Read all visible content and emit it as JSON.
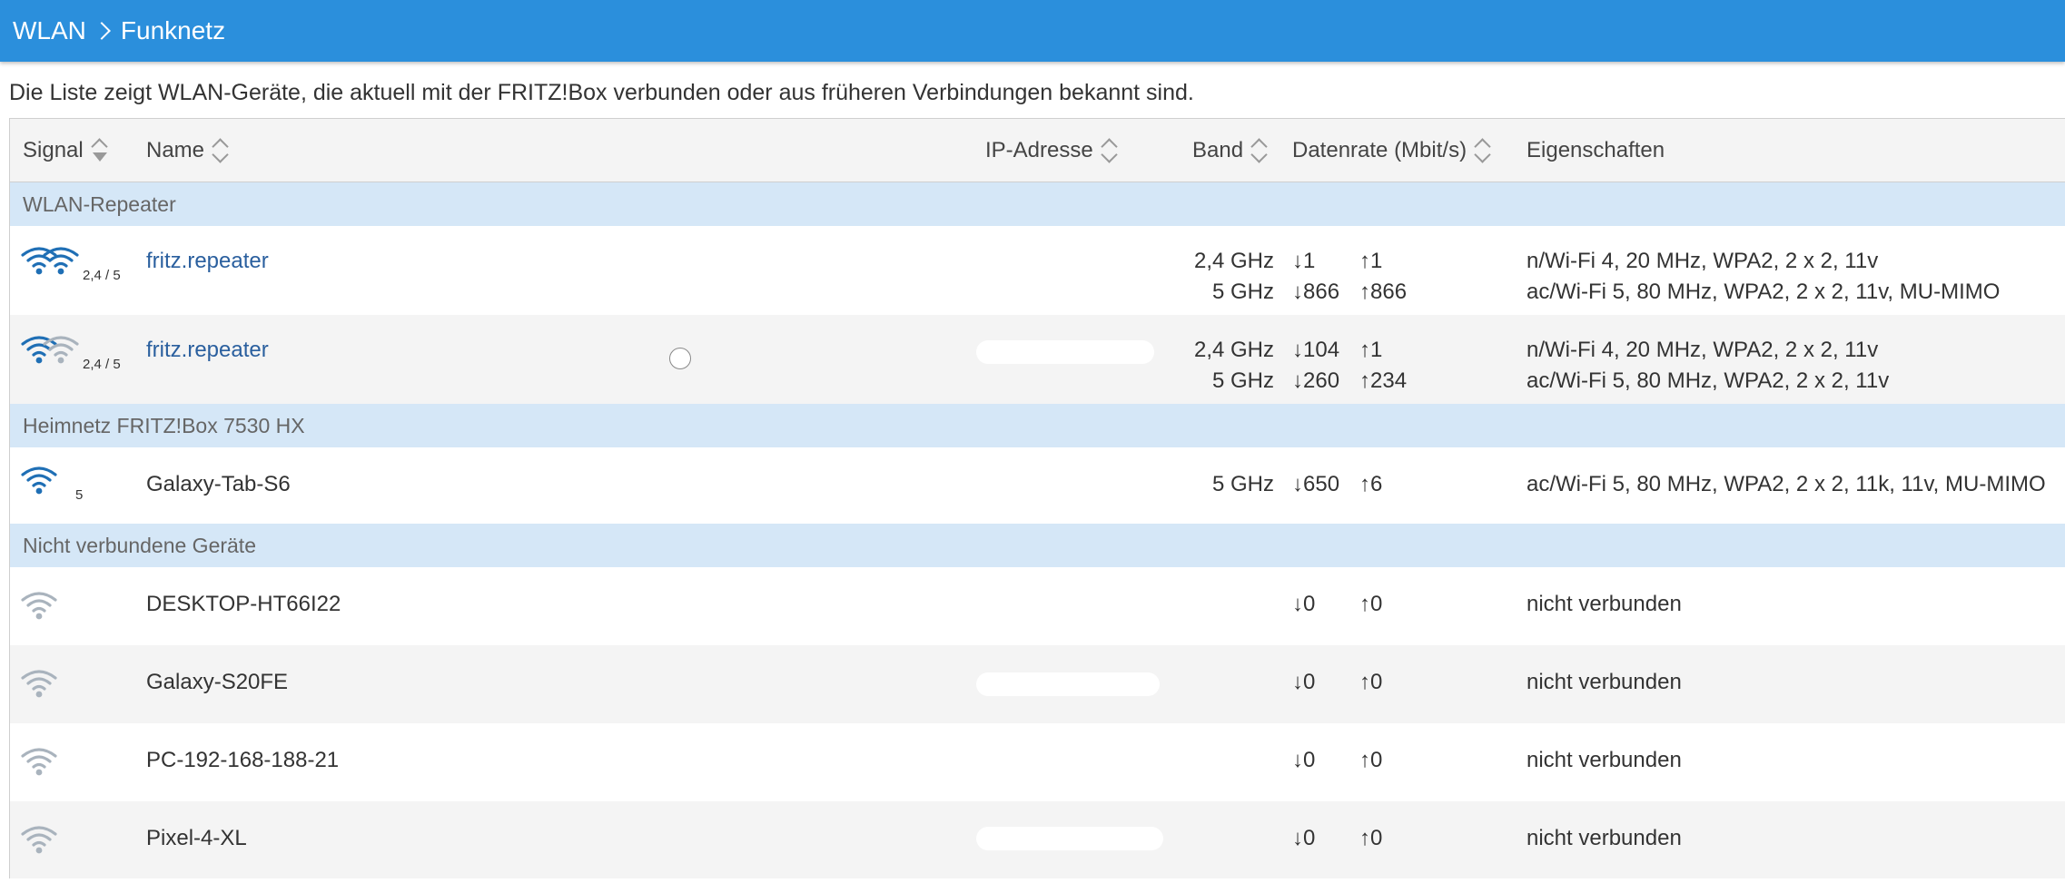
{
  "header": {
    "crumb_wlan": "WLAN",
    "crumb_page": "Funknetz"
  },
  "intro": "Die Liste zeigt WLAN-Geräte, die aktuell mit der FRITZ!Box verbunden oder aus früheren Verbindungen bekannt sind.",
  "columns": {
    "signal": "Signal",
    "name": "Name",
    "ip": "IP-Adresse",
    "band": "Band",
    "rate": "Datenrate (Mbit/s)",
    "props": "Eigenschaften"
  },
  "groups": {
    "repeater": "WLAN-Repeater",
    "heimnetz": "Heimnetz FRITZ!Box 7530 HX",
    "offline": "Nicht verbundene Geräte"
  },
  "devices": {
    "rep1": {
      "name": "fritz.repeater",
      "signal_label": "2,4 / 5",
      "band1": "2,4 GHz",
      "down1": "↓1",
      "up1": "↑1",
      "props1": "n/Wi-Fi 4, 20 MHz, WPA2, 2 x 2, 11v",
      "band2": "5 GHz",
      "down2": "↓866",
      "up2": "↑866",
      "props2": "ac/Wi-Fi 5, 80 MHz, WPA2, 2 x 2, 11v, MU-MIMO"
    },
    "rep2": {
      "name": "fritz.repeater",
      "signal_label": "2,4 / 5",
      "band1": "2,4 GHz",
      "down1": "↓104",
      "up1": "↑1",
      "props1": "n/Wi-Fi 4, 20 MHz, WPA2, 2 x 2, 11v",
      "band2": "5 GHz",
      "down2": "↓260",
      "up2": "↑234",
      "props2": "ac/Wi-Fi 5, 80 MHz, WPA2, 2 x 2, 11v"
    },
    "tab": {
      "name": "Galaxy-Tab-S6",
      "signal_label": "5",
      "band1": "5 GHz",
      "down1": "↓650",
      "up1": "↑6",
      "props1": "ac/Wi-Fi 5, 80 MHz, WPA2, 2 x 2, 11k, 11v, MU-MIMO"
    },
    "desktop": {
      "name": "DESKTOP-HT66I22",
      "down": "↓0",
      "up": "↑0",
      "props": "nicht verbunden"
    },
    "s20": {
      "name": "Galaxy-S20FE",
      "down": "↓0",
      "up": "↑0",
      "props": "nicht verbunden"
    },
    "pc": {
      "name": "PC-192-168-188-21",
      "down": "↓0",
      "up": "↑0",
      "props": "nicht verbunden"
    },
    "pixel": {
      "name": "Pixel-4-XL",
      "down": "↓0",
      "up": "↑0",
      "props": "nicht verbunden"
    }
  },
  "colors": {
    "header_bg": "#2b8fdc",
    "group_bg": "#d5e7f7",
    "signal_active": "#1f6fb5",
    "signal_inactive": "#a9b3bd",
    "link": "#2a5f9e"
  }
}
